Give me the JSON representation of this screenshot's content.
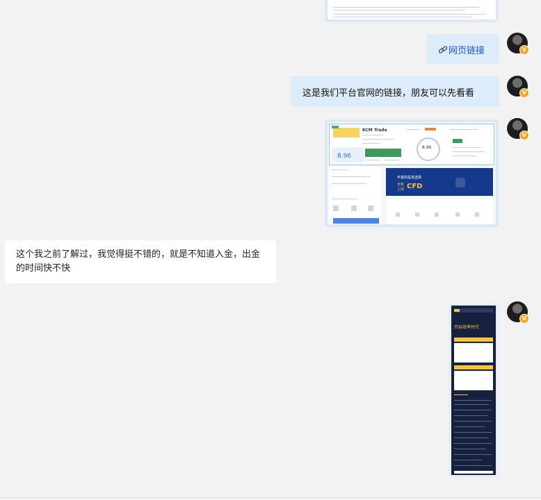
{
  "messages": {
    "link_text": "网页链接",
    "platform_link_text": "这是我们平台官网的链接，朋友可以先看看",
    "customer_message": "这个我之前了解过，我觉得挺不错的，就是不知道入金，出金的时间快不快"
  },
  "platform_card": {
    "brand": "KCM Trade",
    "score": "8.96",
    "gauge_score": "8.96",
    "banner_title": "丰富的投资选择",
    "banner_line1": "全新",
    "banner_line2": "上线",
    "banner_product": "CFD"
  },
  "poster": {
    "title": "开启效率时代"
  },
  "avatar_badge": "V",
  "colors": {
    "bubble_right": "#dcecfb",
    "bubble_left": "#ffffff",
    "background": "#f2f2f2",
    "link": "#1a56c9",
    "badge": "#f5a623"
  }
}
